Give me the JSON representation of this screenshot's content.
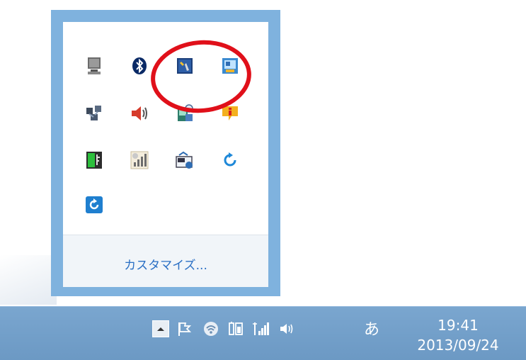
{
  "flyout": {
    "icons": [
      {
        "name": "monitor-icon"
      },
      {
        "name": "bluetooth-icon"
      },
      {
        "name": "tools-icon"
      },
      {
        "name": "display-settings-icon"
      },
      {
        "name": "network-devices-icon"
      },
      {
        "name": "volume-red-icon"
      },
      {
        "name": "network-adapter-icon"
      },
      {
        "name": "info-balloon-icon"
      },
      {
        "name": "usb-device-icon"
      },
      {
        "name": "signal-meter-icon"
      },
      {
        "name": "network-sync-icon"
      },
      {
        "name": "refresh-arrow-icon"
      },
      {
        "name": "sync-app-icon"
      }
    ],
    "customize_label": "カスタマイズ..."
  },
  "taskbar": {
    "ime_label": "あ",
    "time": "19:41",
    "date": "2013/09/24"
  },
  "colors": {
    "flyout_border": "#7fb2de",
    "taskbar": "#6c99c4",
    "highlight_circle": "#e0101a",
    "link": "#2a6fc4"
  }
}
